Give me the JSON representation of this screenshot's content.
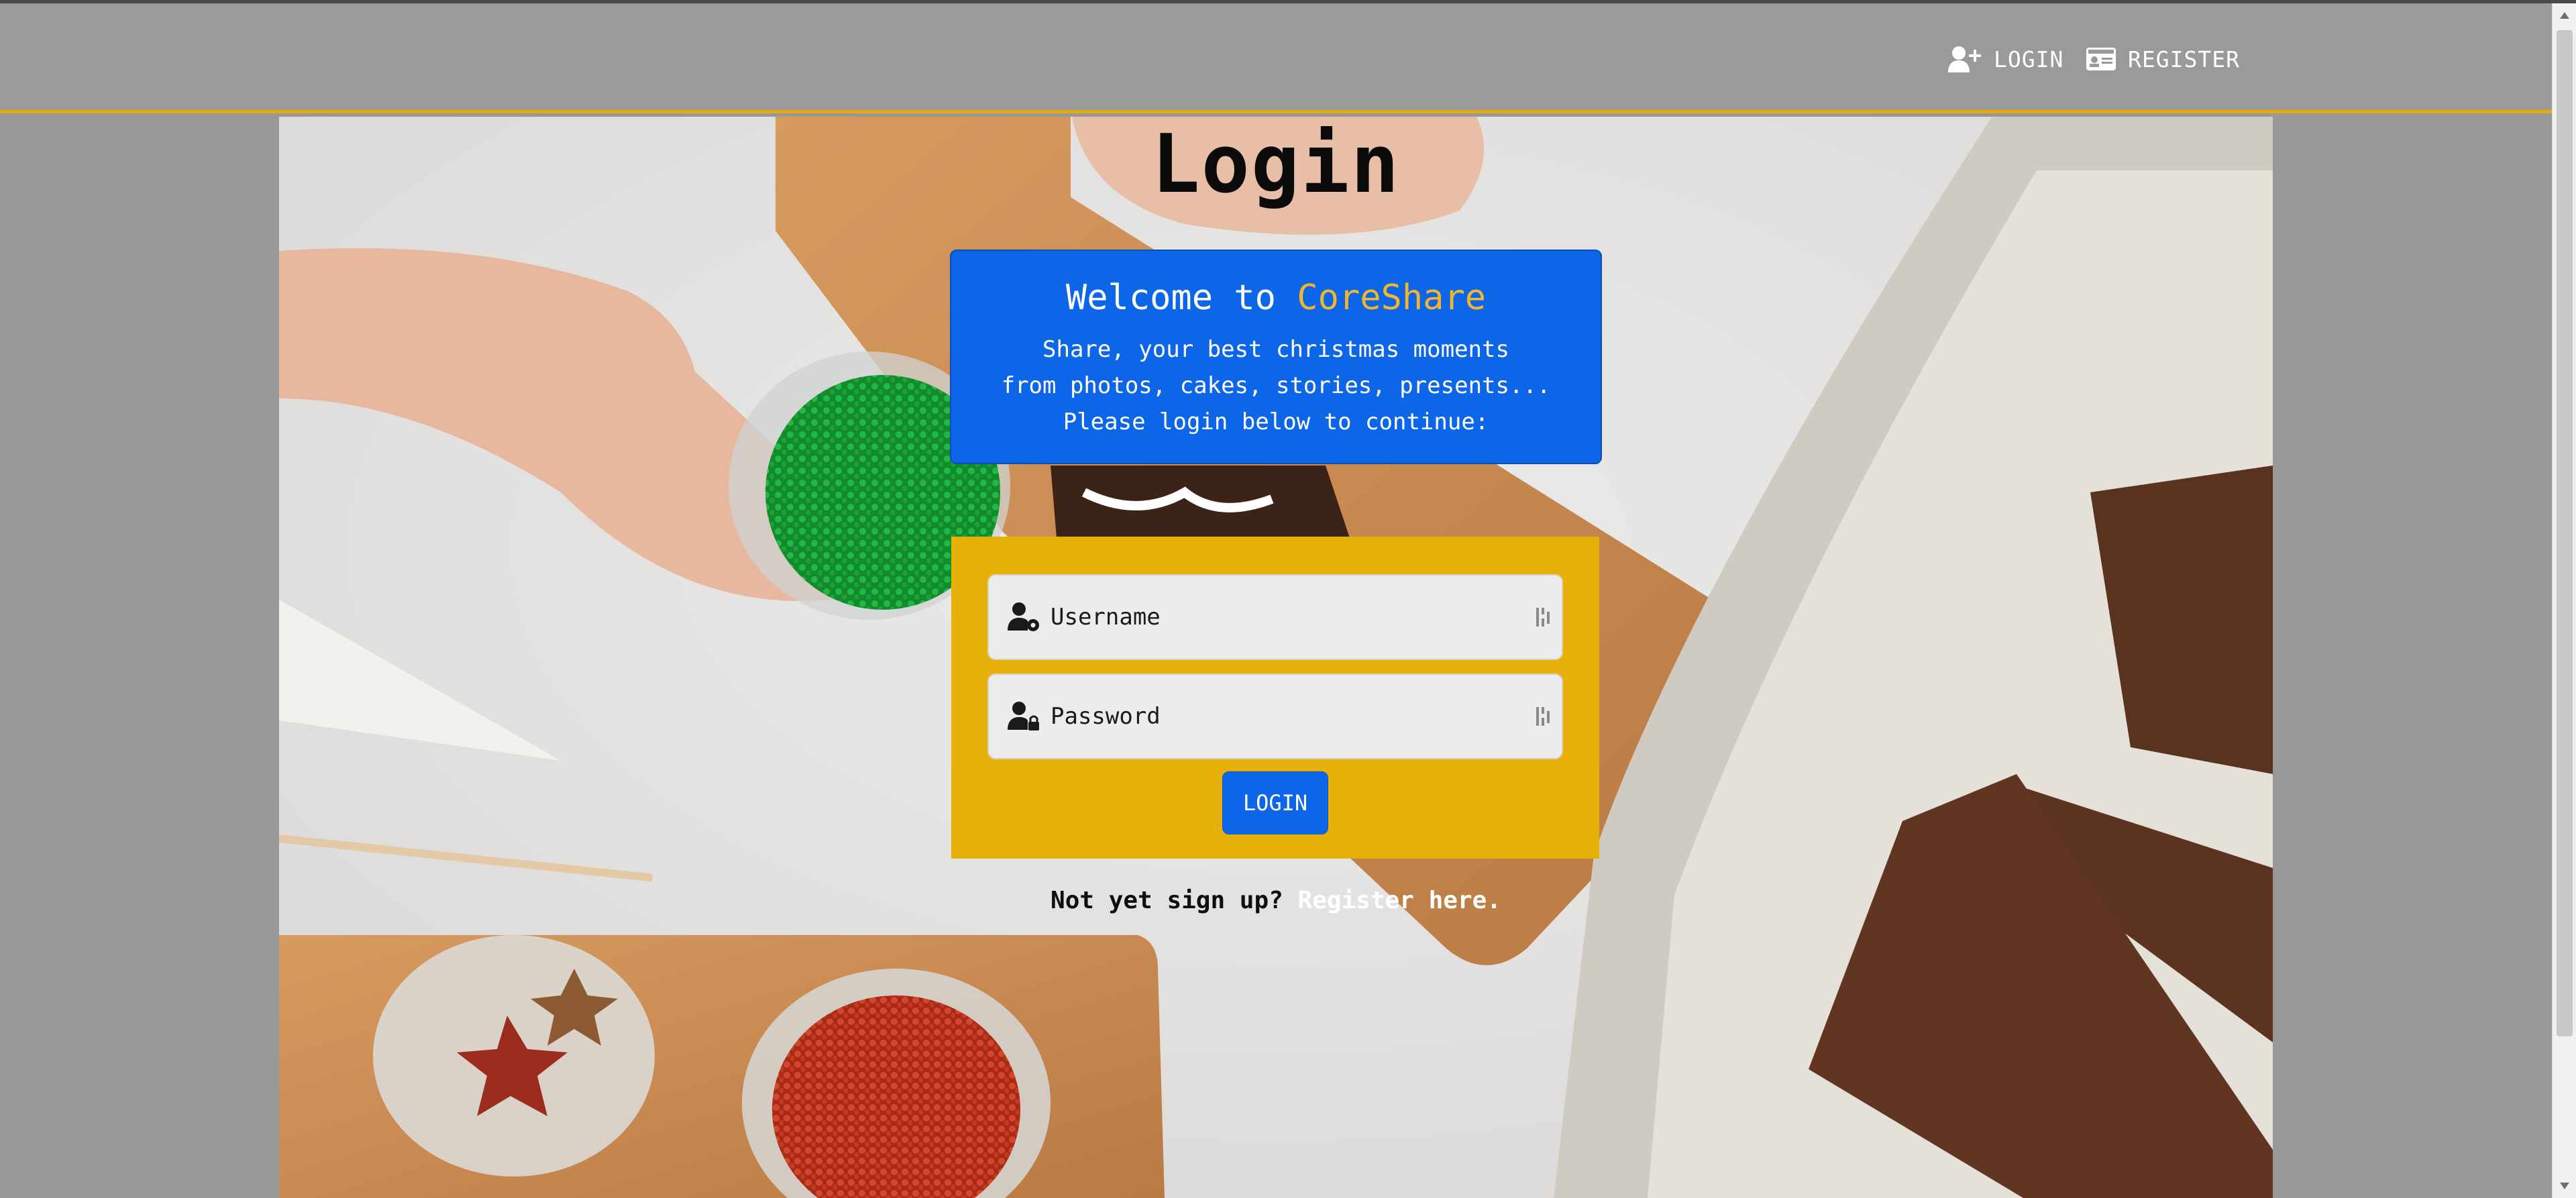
{
  "nav": {
    "login_label": "LOGIN",
    "register_label": "REGISTER",
    "login_icon": "user-plus-icon",
    "register_icon": "id-card-icon"
  },
  "page": {
    "title": "Login"
  },
  "welcome": {
    "prefix": "Welcome to ",
    "brand": "CoreShare",
    "line1": "Share, your best christmas moments",
    "line2": "from photos, cakes, stories, presents...",
    "line3": "Please login below to continue:"
  },
  "form": {
    "username_placeholder": "Username",
    "password_placeholder": "Password",
    "username_icon": "user-gear-icon",
    "password_icon": "user-lock-icon",
    "login_button": "LOGIN"
  },
  "signup": {
    "prompt": "Not yet sign up? ",
    "link": "Register here."
  },
  "colors": {
    "navbar": "#9b9a9b",
    "accent_line": "#e8a90a",
    "primary_blue": "#0d66e8",
    "form_panel": "#e8b00a",
    "brand_text": "#f1b62e"
  }
}
